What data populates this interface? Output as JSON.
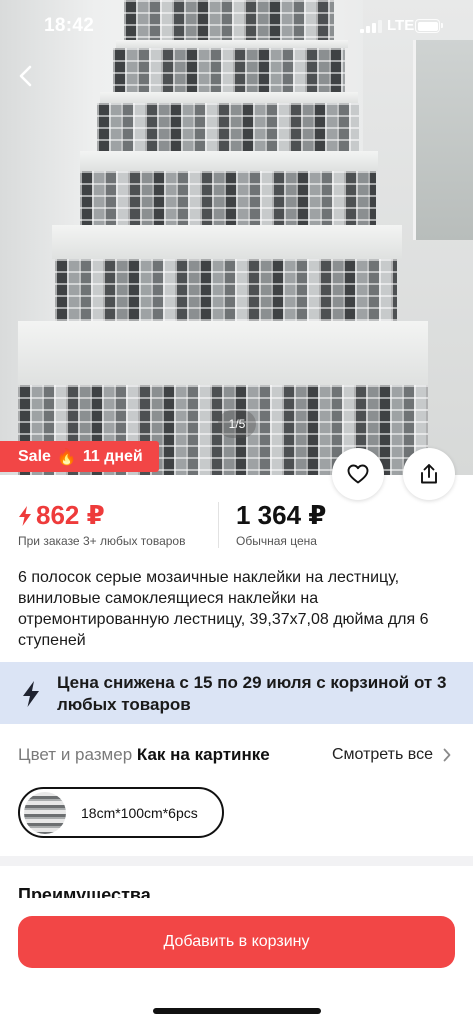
{
  "status_bar": {
    "time": "18:42",
    "network": "LTE",
    "battery_icon": "battery-icon",
    "signal_icon": "signal-icon"
  },
  "gallery": {
    "counter": "1/5",
    "back_icon": "chevron-left-icon"
  },
  "sale_badge": {
    "label": "Sale",
    "icon": "🔥",
    "duration": "11 дней"
  },
  "actions": {
    "favorite_icon": "heart-icon",
    "share_icon": "share-icon"
  },
  "price": {
    "sale_value": "862 ₽",
    "sale_note": "При заказе 3+ любых товаров",
    "regular_value": "1 364 ₽",
    "regular_note": "Обычная цена",
    "accent": "#ee3b3b"
  },
  "product": {
    "title": "6 полосок серые мозаичные наклейки на лестницу, виниловые самоклеящиеся наклейки на отремонтированную лестницу, 39,37x7,08 дюйма для 6 ступеней"
  },
  "promo": {
    "text": "Цена снижена с 15 по 29 июля с корзиной от 3 любых товаров",
    "background": "#dbe4f5",
    "icon": "lightning-icon"
  },
  "options": {
    "label": "Цвет и размер",
    "value": "Как на картинке",
    "see_all": "Смотреть все",
    "variants": [
      {
        "label": "18cm*100cm*6pcs",
        "selected": true
      }
    ]
  },
  "section": {
    "advantages": "Преимущества"
  },
  "cta": {
    "add_to_cart": "Добавить в корзину",
    "color": "#f24646"
  }
}
